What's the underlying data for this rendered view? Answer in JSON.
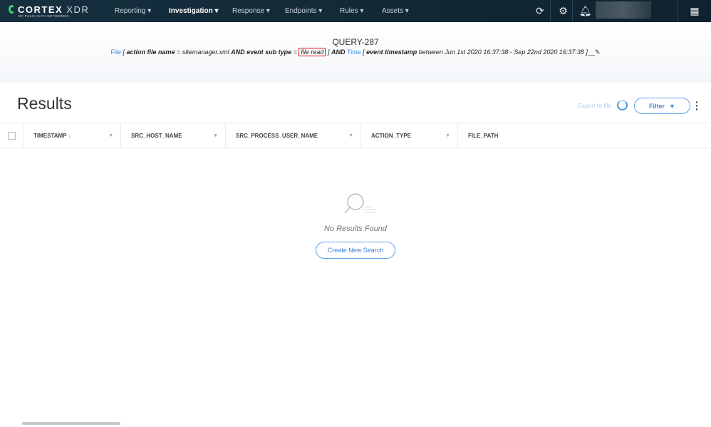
{
  "nav": {
    "brand": "CORTEX",
    "brand_suffix": "XDR",
    "brand_sub": "BY PALO ALTO NETWORKS",
    "items": [
      {
        "label": "Reporting ▾"
      },
      {
        "label": "Investigation ▾"
      },
      {
        "label": "Response ▾"
      },
      {
        "label": "Endpoints ▾"
      },
      {
        "label": "Rules ▾"
      },
      {
        "label": "Assets ▾"
      }
    ],
    "icons": [
      "sync-icon",
      "gear-icon",
      "bell-icon",
      "apps-grid-icon"
    ]
  },
  "query": {
    "title": "QUERY-287",
    "file_label": "File",
    "c1_field": "action file name",
    "c1_op": "=",
    "c1_value": "sitemanager.xml",
    "and1": "AND",
    "c2_field": "event sub type",
    "c2_op": "=",
    "c2_value": "file read",
    "and2": "AND",
    "time_label": "Time",
    "c3_field": "event timestamp",
    "c3_value": "between Jun 1st 2020 16:37:38 - Sep 22nd 2020 16:37:38"
  },
  "results": {
    "title": "Results",
    "export_label": "Export to file",
    "filter_label": "Filter"
  },
  "table": {
    "columns": [
      {
        "label": "TIMESTAMP"
      },
      {
        "label": "SRC_HOST_NAME"
      },
      {
        "label": "SRC_PROCESS_USER_NAME"
      },
      {
        "label": "ACTION_TYPE"
      },
      {
        "label": "FILE_PATH"
      }
    ]
  },
  "empty": {
    "message": "No Results Found",
    "button": "Create New Search"
  },
  "colors": {
    "accent": "#3a8ee6",
    "nav_bg": "#16303f",
    "highlight": "#e01b1b"
  }
}
